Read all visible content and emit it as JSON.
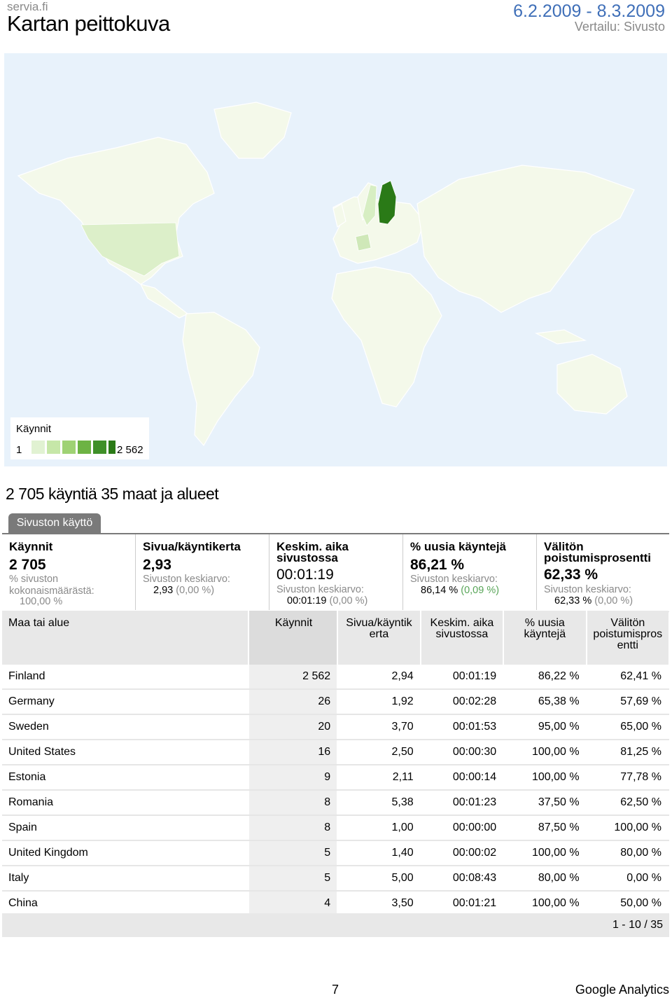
{
  "header": {
    "site": "servia.fi",
    "title": "Kartan peittokuva",
    "date_range": "6.2.2009 - 8.3.2009",
    "compare": "Vertailu: Sivusto"
  },
  "map": {
    "legend": {
      "title": "Käynnit",
      "min": "1",
      "max": "2 562"
    },
    "colors": {
      "ocean": "#e8f2fb",
      "land": "#f4f9ea",
      "low": "#dcefc9",
      "high": "#2a7a17",
      "border": "#ffffff"
    }
  },
  "summary": "2 705 käyntiä 35 maat ja alueet",
  "tab_label": "Sivuston käyttö",
  "metrics": [
    {
      "head": "Käynnit",
      "value": "2 705",
      "label1": "% sivuston",
      "label2": "kokonaismäärästä:",
      "avg": "100,00 %",
      "delta": ""
    },
    {
      "head": "Sivua/käyntikerta",
      "value": "2,93",
      "label1": "Sivuston keskiarvo:",
      "label2": "",
      "avg": "2,93",
      "delta": "(0,00 %)"
    },
    {
      "head1": "Keskim. aika",
      "head2": "sivustossa",
      "value": "00:01:19",
      "label1": "Sivuston keskiarvo:",
      "label2": "",
      "avg": "00:01:19",
      "delta": "(0,00 %)"
    },
    {
      "head": "% uusia käyntejä",
      "value": "86,21 %",
      "label1": "Sivuston keskiarvo:",
      "label2": "",
      "avg": "86,14 %",
      "delta": "(0,09 %)"
    },
    {
      "head1": "Välitön",
      "head2": "poistumisprosentti",
      "value": "62,33 %",
      "label1": "Sivuston keskiarvo:",
      "label2": "",
      "avg": "62,33 %",
      "delta": "(0,00 %)"
    }
  ],
  "table": {
    "headers": [
      [
        "Maa tai alue"
      ],
      [
        "Käynnit"
      ],
      [
        "Sivua/käyntik",
        "erta"
      ],
      [
        "Keskim. aika",
        "sivustossa"
      ],
      [
        "% uusia",
        "käyntejä"
      ],
      [
        "Välitön",
        "poistumispros",
        "entti"
      ]
    ],
    "rows": [
      [
        "Finland",
        "2 562",
        "2,94",
        "00:01:19",
        "86,22 %",
        "62,41 %"
      ],
      [
        "Germany",
        "26",
        "1,92",
        "00:02:28",
        "65,38 %",
        "57,69 %"
      ],
      [
        "Sweden",
        "20",
        "3,70",
        "00:01:53",
        "95,00 %",
        "65,00 %"
      ],
      [
        "United States",
        "16",
        "2,50",
        "00:00:30",
        "100,00 %",
        "81,25 %"
      ],
      [
        "Estonia",
        "9",
        "2,11",
        "00:00:14",
        "100,00 %",
        "77,78 %"
      ],
      [
        "Romania",
        "8",
        "5,38",
        "00:01:23",
        "37,50 %",
        "62,50 %"
      ],
      [
        "Spain",
        "8",
        "1,00",
        "00:00:00",
        "87,50 %",
        "100,00 %"
      ],
      [
        "United Kingdom",
        "5",
        "1,40",
        "00:00:02",
        "100,00 %",
        "80,00 %"
      ],
      [
        "Italy",
        "5",
        "5,00",
        "00:08:43",
        "80,00 %",
        "0,00 %"
      ],
      [
        "China",
        "4",
        "3,50",
        "00:01:21",
        "100,00 %",
        "50,00 %"
      ]
    ],
    "pager": "1 - 10 / 35"
  },
  "footer": {
    "page": "7",
    "brand": "Google Analytics"
  }
}
